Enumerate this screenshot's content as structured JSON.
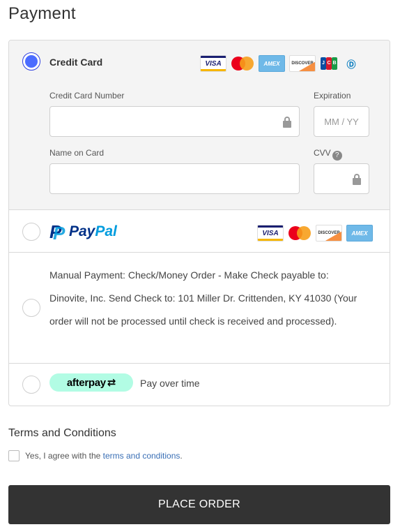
{
  "page": {
    "title": "Payment"
  },
  "methods": {
    "credit_card": {
      "label": "Credit Card",
      "selected": true,
      "logos": [
        "VISA",
        "mastercard",
        "AMEX",
        "DISCOVER",
        "JCB",
        "diners"
      ],
      "fields": {
        "number_label": "Credit Card Number",
        "expiration_label": "Expiration",
        "expiration_placeholder": "MM / YY",
        "name_label": "Name on Card",
        "cvv_label": "CVV",
        "help_glyph": "?"
      }
    },
    "paypal": {
      "logo_pay": "Pay",
      "logo_pal": "Pal",
      "logo_mark": "P",
      "logos": [
        "VISA",
        "mastercard",
        "DISCOVER",
        "AMEX"
      ]
    },
    "manual": {
      "text": "Manual Payment: Check/Money Order - Make Check payable to: Dinovite, Inc. Send Check to: 101 Miller Dr. Crittenden, KY 41030 (Your order will not be processed until check is received and processed)."
    },
    "afterpay": {
      "badge": "afterpay",
      "badge_icon": "⇄",
      "text": "Pay over time"
    }
  },
  "terms": {
    "title": "Terms and Conditions",
    "prefix": "Yes, I agree with the ",
    "link": "terms and conditions",
    "suffix": "."
  },
  "actions": {
    "place_order": "PLACE ORDER"
  },
  "colors": {
    "radio_selected": "#4b6cff",
    "button_bg": "#333333",
    "link": "#3a6fb5",
    "afterpay_bg": "#b2fce4"
  }
}
